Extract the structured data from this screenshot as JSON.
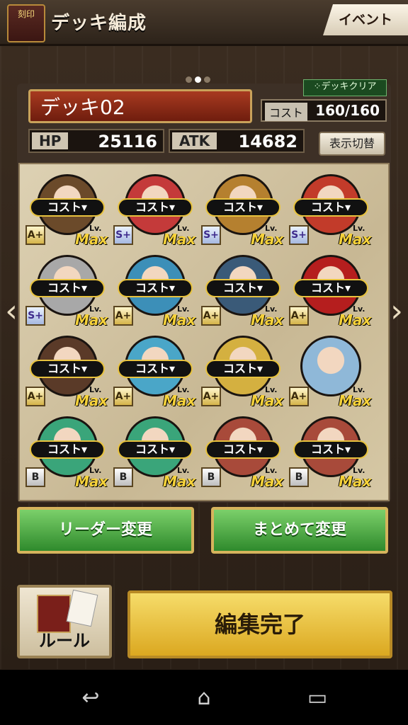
{
  "header": {
    "logo_text": "刻印",
    "title": "デッキ編成",
    "event_label": "イベント"
  },
  "deck": {
    "name": "デッキ02",
    "clear_label": "⁘デッキクリア",
    "cost_label": "コスト",
    "cost_value": "160/160",
    "hp_label": "HP",
    "hp_value": "25116",
    "atk_label": "ATK",
    "atk_value": "14682",
    "toggle_label": "表示切替"
  },
  "cards": [
    {
      "cost": "コスト▾",
      "rank": "A+",
      "lv": "Lv.",
      "max": "Max",
      "color": "#6b4a2a"
    },
    {
      "cost": "コスト▾",
      "rank": "S+",
      "lv": "Lv.",
      "max": "Max",
      "color": "#c43a3a"
    },
    {
      "cost": "コスト▾",
      "rank": "S+",
      "lv": "Lv.",
      "max": "Max",
      "color": "#b5802f"
    },
    {
      "cost": "コスト▾",
      "rank": "S+",
      "lv": "Lv.",
      "max": "Max",
      "color": "#c23b2a"
    },
    {
      "cost": "コスト▾",
      "rank": "S+",
      "lv": "Lv.",
      "max": "Max",
      "color": "#a8a8a8"
    },
    {
      "cost": "コスト▾",
      "rank": "A+",
      "lv": "Lv.",
      "max": "Max",
      "color": "#3c8fb8"
    },
    {
      "cost": "コスト▾",
      "rank": "A+",
      "lv": "Lv.",
      "max": "Max",
      "color": "#3a5a78"
    },
    {
      "cost": "コスト▾",
      "rank": "A+",
      "lv": "Lv.",
      "max": "Max",
      "color": "#b51e1e"
    },
    {
      "cost": "コスト▾",
      "rank": "A+",
      "lv": "Lv.",
      "max": "Max",
      "color": "#5a3a28"
    },
    {
      "cost": "コスト▾",
      "rank": "A+",
      "lv": "Lv.",
      "max": "Max",
      "color": "#4aa6c8"
    },
    {
      "cost": "コスト▾",
      "rank": "A+",
      "lv": "Lv.",
      "max": "Max",
      "color": "#d4b040"
    },
    {
      "cost": "",
      "rank": "A+",
      "lv": "Lv.",
      "max": "Max",
      "color": "#8fb8d8"
    },
    {
      "cost": "コスト▾",
      "rank": "B",
      "lv": "Lv.",
      "max": "Max",
      "color": "#3aa57a"
    },
    {
      "cost": "コスト▾",
      "rank": "B",
      "lv": "Lv.",
      "max": "Max",
      "color": "#3aa57a"
    },
    {
      "cost": "コスト▾",
      "rank": "B",
      "lv": "Lv.",
      "max": "Max",
      "color": "#a84a3a"
    },
    {
      "cost": "コスト▾",
      "rank": "B",
      "lv": "Lv.",
      "max": "Max",
      "color": "#a84a3a"
    }
  ],
  "buttons": {
    "leader_change": "リーダー変更",
    "bulk_change": "まとめて変更",
    "rules": "ルール",
    "done": "編集完了"
  },
  "nav": {
    "back_icon": "↩",
    "home_icon": "⌂",
    "recent_icon": "▭"
  }
}
